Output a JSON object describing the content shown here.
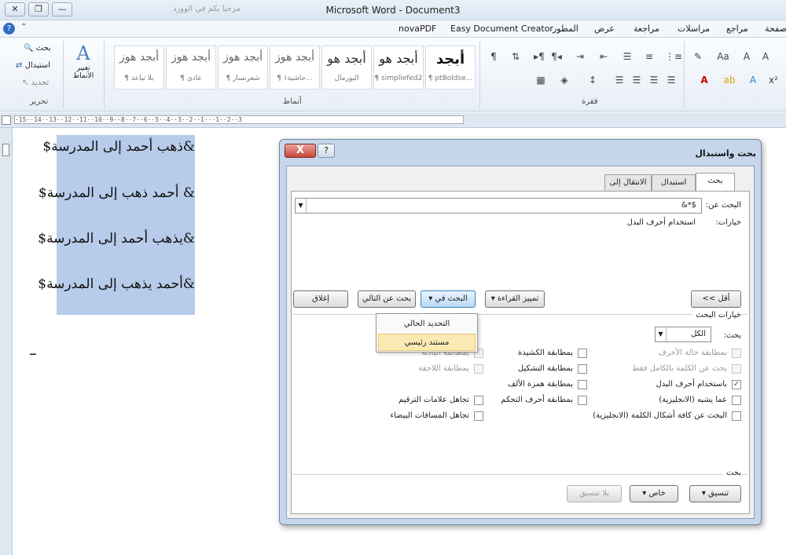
{
  "titlebar": {
    "title": "Microsoft Word - Document3",
    "left_text": "مرحبا بكم في الوورد"
  },
  "tabs": [
    "صفحة",
    "مراجع",
    "مراسلات",
    "مراجعة",
    "عرض",
    "المطور",
    "Easy Document Creator",
    "novaPDF"
  ],
  "ribbon": {
    "editing": {
      "find": "بحث",
      "replace": "استبدال",
      "select": "تحديد",
      "group": "تحرير"
    },
    "change_styles": "تغيير الأنماط",
    "styles": [
      {
        "big": "أبجد هوز",
        "small": "¶ بلا تباعد"
      },
      {
        "big": "أبجد هوز",
        "small": "¶ عادي"
      },
      {
        "big": "أبجد هوز",
        "small": "¶ شعرنسار"
      },
      {
        "big": "أبجد هوز",
        "small": "¶ حاشية١..."
      },
      {
        "big": "أبجد هو",
        "small": "البورمال"
      },
      {
        "big": "أبجد هو",
        "small": "¶ simpliefed2"
      },
      {
        "big": "أبجد",
        "small": "¶ ptBoldse..."
      }
    ],
    "styles_group": "أنماط",
    "paragraph_group": "فقرة"
  },
  "ruler_text": "·15··14··13··12··11··10··9··8··7··6··5··4··3··2··1···1··2··3",
  "document": {
    "lines": [
      "&ذهب أحمد إلى المدرسة$",
      "& أحمد ذهب إلى المدرسة$",
      "&يذهب أحمد إلى المدرسة$",
      "&أحمد يذهب إلى المدرسة$"
    ],
    "cursor": "_"
  },
  "dialog": {
    "title": "بحث واستبدال",
    "close": "X",
    "help": "?",
    "tabs": [
      "بحث",
      "استبدال",
      "الانتقال إلى"
    ],
    "find_label": "البحث عن:",
    "find_value": "&*$",
    "options_label": "خيارات:",
    "options_value": "استخدام أحرف البدل",
    "buttons": {
      "less": "<< أقل",
      "reading": "تمييز القراءة",
      "find_in": "البحث في",
      "find_next": "بحث عن التالي",
      "close": "إغلاق"
    },
    "dropdown": [
      "التحديد الحالي",
      "مستند رئيسي"
    ],
    "search_options_title": "خيارات البحث",
    "search_label": "بحث:",
    "search_value": "الكل",
    "col_right": [
      {
        "label": "بمطابقة حالة الأحرف",
        "checked": false,
        "disabled": true
      },
      {
        "label": "بحث عن الكلمة بالكامل فقط",
        "checked": false,
        "disabled": true
      },
      {
        "label": "باستخدام أحرف البدل",
        "checked": true,
        "disabled": false
      },
      {
        "label": "عما يشبه (الانجليزية)",
        "checked": false,
        "disabled": false
      },
      {
        "label": "البحث عن كافة أشكال الكلمة (الانجليزية)",
        "checked": false,
        "disabled": false
      }
    ],
    "col_mid": [
      {
        "label": "بمطابقة الكشيدة",
        "checked": false
      },
      {
        "label": "بمطابقة التشكيل",
        "checked": false
      },
      {
        "label": "بمطابقة همزة الألف",
        "checked": false
      },
      {
        "label": "بمطابقة أحرف التحكم",
        "checked": false
      }
    ],
    "col_left": [
      {
        "label": "بمطابقة البادئة",
        "checked": false,
        "disabled": true
      },
      {
        "label": "بمطابقة اللاحقة",
        "checked": false,
        "disabled": true
      },
      {
        "label": "تجاهل علامات الترقيم",
        "checked": false,
        "disabled": false
      },
      {
        "label": "تجاهل المسافات البيضاء",
        "checked": false,
        "disabled": false
      }
    ],
    "find_section": "بحث",
    "format_btn": "تنسيق",
    "special_btn": "خاص",
    "noformat_btn": "بلا تنسيق"
  }
}
